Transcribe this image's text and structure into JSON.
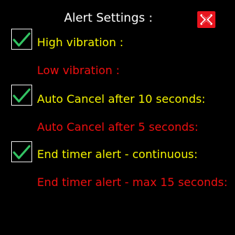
{
  "header": {
    "title": "Alert Settings :",
    "close_icon": "close-x-icon"
  },
  "colors": {
    "background": "#000000",
    "enabled_text": "#f4f400",
    "disabled_text": "#f01010",
    "check_mark": "#33c463",
    "close_background": "#e8141e"
  },
  "options": [
    {
      "label": "High vibration :",
      "checked": true
    },
    {
      "label": "Low vibration :",
      "checked": false
    },
    {
      "label": "Auto Cancel after 10 seconds:",
      "checked": true
    },
    {
      "label": "Auto Cancel  after 5 seconds:",
      "checked": false
    },
    {
      "label": "End timer alert - continuous:",
      "checked": true
    },
    {
      "label": "End timer alert - max 15 seconds:",
      "checked": false
    }
  ]
}
